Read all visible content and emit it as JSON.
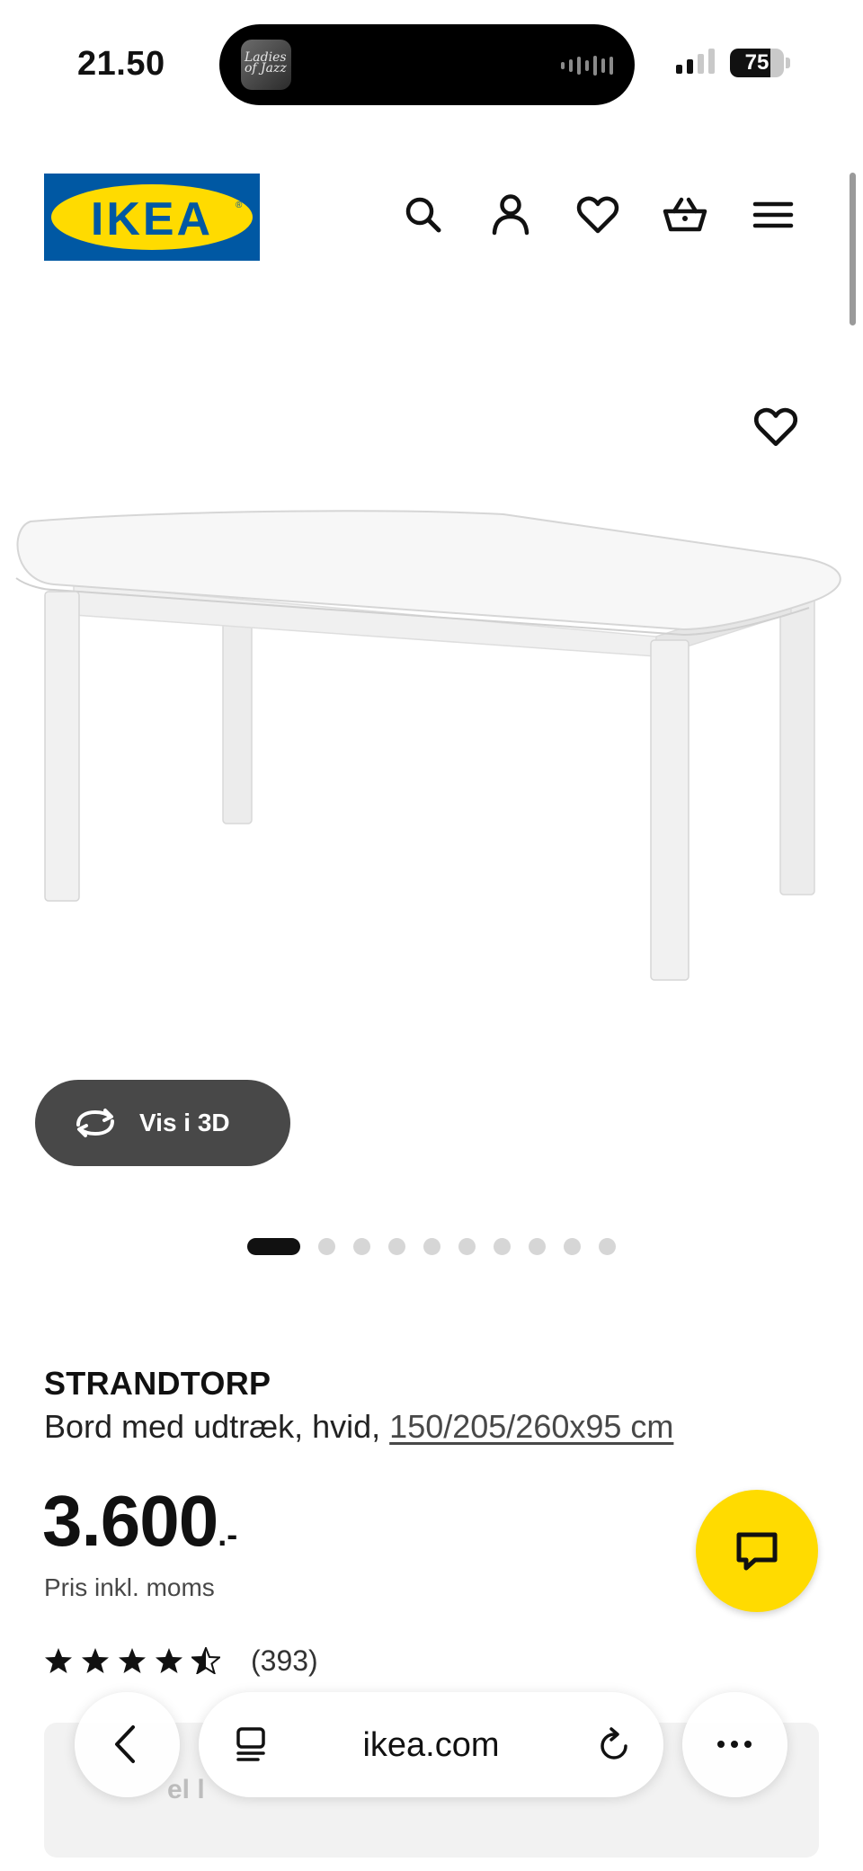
{
  "status_bar": {
    "time": "21.50",
    "now_playing_art_text": "Ladies of Jazz",
    "battery_level": "75",
    "icons": [
      "album-art",
      "audio-waveform-icon",
      "cellular-signal-icon",
      "battery-icon"
    ]
  },
  "header": {
    "logo_text": "IKEA",
    "logo_colors": {
      "blue": "#0058a3",
      "yellow": "#ffdb00"
    },
    "icons": [
      "search-icon",
      "account-icon",
      "heart-icon",
      "basket-icon",
      "menu-icon"
    ]
  },
  "gallery": {
    "view_3d_label": "Vis i 3D",
    "slide_count": 10,
    "active_slide": 1
  },
  "product": {
    "name": "STRANDTORP",
    "description": "Bord med udtræk, hvid, ",
    "dimensions_link": "150/205/260x95 cm",
    "price": "3.600",
    "price_suffix": ".-",
    "vat_note": "Pris inkl. moms",
    "rating": 4.5,
    "review_count": "(393)"
  },
  "hidden_card": {
    "label_fragment": "el l"
  },
  "browser": {
    "domain": "ikea.com",
    "icons": [
      "back-chevron-icon",
      "tabs-icon",
      "reload-icon",
      "more-icon"
    ]
  },
  "colors": {
    "chat_button": "#ffdb00",
    "view_3d_button": "#484848",
    "text": "#111111"
  }
}
